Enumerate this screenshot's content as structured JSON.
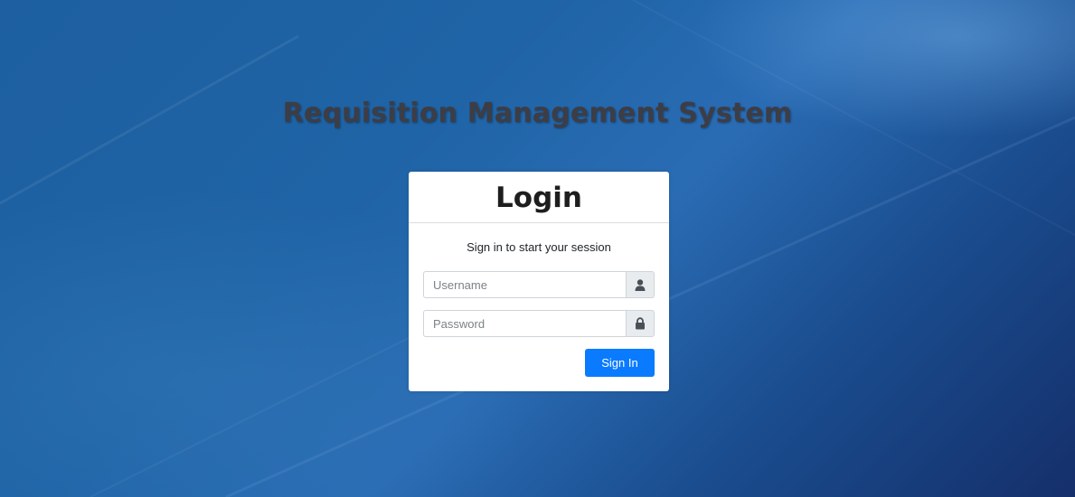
{
  "header": {
    "app_title": "Requisition Management System"
  },
  "login": {
    "title": "Login",
    "message": "Sign in to start your session",
    "username_placeholder": "Username",
    "username_icon": "user-icon",
    "password_placeholder": "Password",
    "password_icon": "lock-icon",
    "submit_label": "Sign In"
  },
  "colors": {
    "primary_button": "#0a7bff",
    "background_blue": "#1f64a6",
    "title_text": "#3d3d45"
  }
}
